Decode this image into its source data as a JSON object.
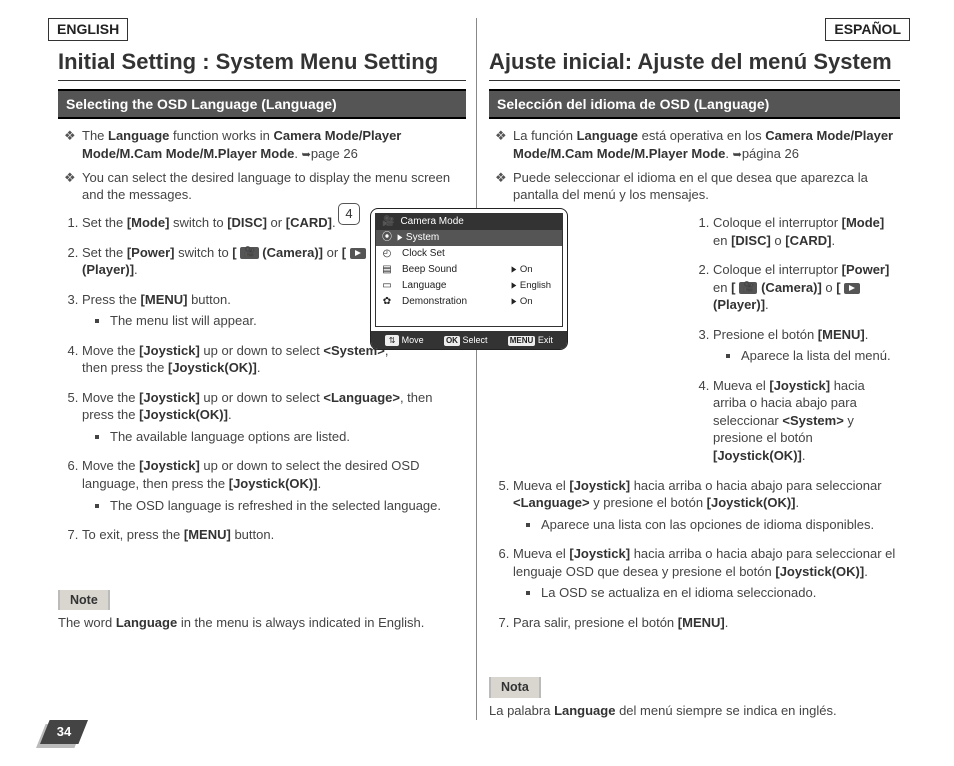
{
  "page_number": "34",
  "left": {
    "lang_label": "ENGLISH",
    "title": "Initial Setting : System Menu Setting",
    "section": "Selecting the OSD Language (Language)",
    "bullets": [
      "The <strong>Language</strong> function works in <strong>Camera Mode/Player Mode/M.Cam Mode/M.Player Mode</strong>. <span class='page-arrow'>➥</span>page 26",
      "You can select the desired language to display the menu screen and the messages."
    ],
    "steps_upper": [
      "Set the <strong>[Mode]</strong> switch to <strong>[DISC]</strong> or <strong>[CARD]</strong>.",
      "Set the <strong>[Power]</strong> switch to <strong>[ <span class='cam-icon' data-name='camera-icon' data-interactable='false'></span> (Camera)]</strong> or <strong>[ <span class='play-icon' data-name='play-icon' data-interactable='false'></span> (Player)]</strong>.",
      "Press the <strong>[MENU]</strong> button.",
      "Move the <strong>[Joystick]</strong> up or down to select <strong>&lt;System&gt;</strong>, then press the <strong>[Joystick(OK)]</strong>."
    ],
    "sub3": "The menu list will appear.",
    "steps_lower": [
      "Move the <strong>[Joystick]</strong> up or down to select <strong>&lt;Language&gt;</strong>, then press the <strong>[Joystick(OK)]</strong>.",
      "Move the <strong>[Joystick]</strong> up or down to select the desired OSD language, then press the <strong>[Joystick(OK)]</strong>.",
      "To exit, press the <strong>[MENU]</strong> button."
    ],
    "sub5": "The available language options are listed.",
    "sub6": "The OSD language is refreshed in the selected language.",
    "note_label": "Note",
    "note_text": "The word <strong>Language</strong> in the menu is always indicated in English."
  },
  "right": {
    "lang_label": "ESPAÑOL",
    "title": "Ajuste inicial: Ajuste del menú System",
    "section": "Selección del idioma de OSD (Language)",
    "bullets": [
      "La función <strong>Language</strong> está operativa en los <strong>Camera Mode/Player Mode/M.Cam Mode/M.Player Mode</strong>. <span class='page-arrow'>➥</span>página 26",
      "Puede seleccionar el idioma en el que desea que aparezca la pantalla del menú y los mensajes."
    ],
    "steps_upper": [
      "Coloque el interruptor <strong>[Mode]</strong> en <strong>[DISC]</strong> o <strong>[CARD]</strong>.",
      "Coloque el interruptor <strong>[Power]</strong> en <strong>[ <span class='cam-icon' data-name='camera-icon' data-interactable='false'></span> (Camera)]</strong> o <strong>[ <span class='play-icon' data-name='play-icon' data-interactable='false'></span> (Player)]</strong>.",
      "Presione el botón <strong>[MENU]</strong>.",
      "Mueva el <strong>[Joystick]</strong> hacia arriba o hacia abajo para seleccionar <strong>&lt;System&gt;</strong> y presione el botón <strong>[Joystick(OK)]</strong>."
    ],
    "sub3": "Aparece la lista del menú.",
    "steps_lower": [
      "Mueva el <strong>[Joystick]</strong> hacia arriba o hacia abajo para seleccionar <strong>&lt;Language&gt;</strong> y presione el botón <strong>[Joystick(OK)]</strong>.",
      "Mueva el <strong>[Joystick]</strong> hacia arriba o hacia abajo para seleccionar el lenguaje OSD que desea y presione el botón <strong>[Joystick(OK)]</strong>.",
      "Para salir, presione el botón <strong>[MENU]</strong>."
    ],
    "sub5": "Aparece una lista con las opciones de idioma disponibles.",
    "sub6": "La OSD se actualiza en el idioma seleccionado.",
    "note_label": "Nota",
    "note_text": "La palabra <strong>Language</strong> del menú siempre se indica en inglés."
  },
  "lcd": {
    "step_num": "4",
    "title": "Camera Mode",
    "selected": "System",
    "rows": [
      {
        "label": "Clock Set",
        "val": ""
      },
      {
        "label": "Beep Sound",
        "val": "On"
      },
      {
        "label": "Language",
        "val": "English"
      },
      {
        "label": "Demonstration",
        "val": "On"
      }
    ],
    "footer": {
      "move": "Move",
      "ok": "OK",
      "select": "Select",
      "menu": "MENU",
      "exit": "Exit"
    }
  }
}
